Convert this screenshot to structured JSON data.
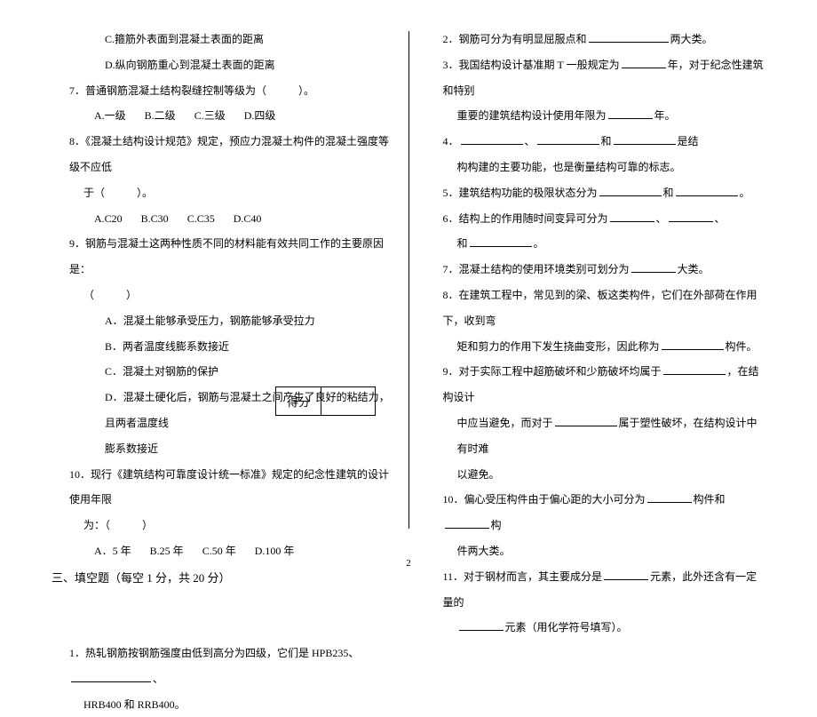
{
  "left": {
    "q6_optC": "C.箍筋外表面到混凝土表面的距离",
    "q6_optD": "D.纵向钢筋重心到混凝土表面的距离",
    "q7": "7．普通钢筋混凝土结构裂缝控制等级为（　　　）。",
    "q7_opts": {
      "a": "A.一级",
      "b": "B.二级",
      "c": "C.三级",
      "d": "D.四级"
    },
    "q8": "8．《混凝土结构设计规范》规定，预应力混凝土构件的混凝土强度等级不应低",
    "q8b": "于（　　　）。",
    "q8_opts": {
      "a": "A.C20",
      "b": "B.C30",
      "c": "C.C35",
      "d": "D.C40"
    },
    "q9": "9．钢筋与混凝土这两种性质不同的材料能有效共同工作的主要原因是：",
    "q9b": "（　　　）",
    "q9_optA": "A．混凝土能够承受压力，钢筋能够承受拉力",
    "q9_optB": "B．两者温度线膨系数接近",
    "q9_optC": "C．混凝土对钢筋的保护",
    "q9_optD": "D．混凝土硬化后，钢筋与混凝土之间产生了良好的粘结力，且两者温度线",
    "q9_optD2": "膨系数接近",
    "q10": "10．现行《建筑结构可靠度设计统一标准》规定的纪念性建筑的设计使用年限",
    "q10b": "为：（　　　）",
    "q10_opts": {
      "a": "A．5 年",
      "b": "B.25 年",
      "c": "C.50 年",
      "d": "D.100 年"
    },
    "section3": "三、填空题（每空 1 分，共 20 分）",
    "score_label": "得分",
    "fill1a": "1．热轧钢筋按钢筋强度由低到高分为四级，它们是 HPB235、",
    "fill1b": "HRB400 和 RRB400。"
  },
  "right": {
    "f2a": "2．钢筋可分为有明显屈服点和",
    "f2b": "两大类。",
    "f3a": "3．我国结构设计基准期 T 一般规定为",
    "f3b": "年，对于纪念性建筑和特别",
    "f3c": "重要的建筑结构设计使用年限为",
    "f3d": "年。",
    "f4a": "4．",
    "f4b": "、",
    "f4c": "和",
    "f4d": "是结",
    "f4e": "构构建的主要功能，也是衡量结构可靠的标志。",
    "f5a": "5．建筑结构功能的极限状态分为",
    "f5b": "和",
    "f5c": "。",
    "f6a": "6．结构上的作用随时间变异可分为",
    "f6b": "、",
    "f6c": "、",
    "f6d": "和",
    "f6e": "。",
    "f7a": "7．混凝土结构的使用环境类别可划分为",
    "f7b": "大类。",
    "f8a": "8．在建筑工程中，常见到的梁、板这类构件，它们在外部荷在作用下，收到弯",
    "f8b": "矩和剪力的作用下发生挠曲变形，因此称为",
    "f8c": "构件。",
    "f9a": "9．对于实际工程中超筋破坏和少筋破坏均属于",
    "f9b": "，在结构设计",
    "f9c": "中应当避免，而对于",
    "f9d": "属于塑性破坏，在结构设计中有时难",
    "f9e": "以避免。",
    "f10a": "10．偏心受压构件由于偏心距的大小可分为",
    "f10b": "构件和",
    "f10c": "构",
    "f10d": "件两大类。",
    "f11a": "11．对于钢材而言，其主要成分是",
    "f11b": "元素，此外还含有一定量的",
    "f11c": "元素（用化学符号填写）。"
  },
  "page_number": "2"
}
